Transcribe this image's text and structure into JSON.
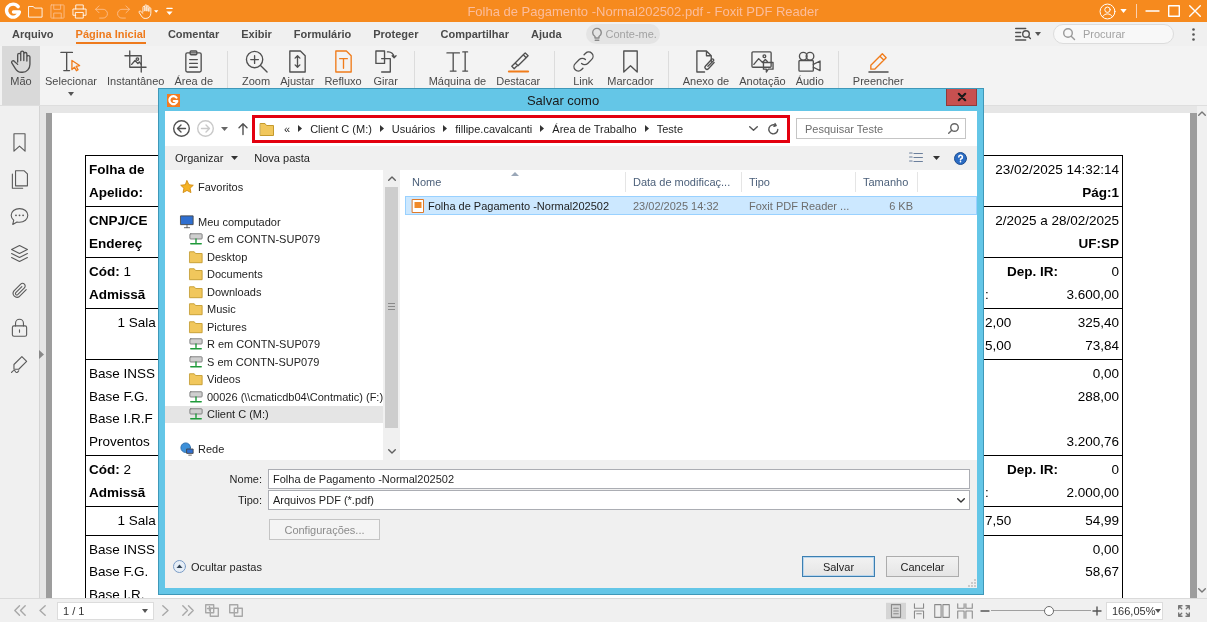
{
  "window": {
    "title": "Folha de Pagamento -Normal202502.pdf - Foxit PDF Reader",
    "quick_access": [
      {
        "disabled": false
      },
      {
        "disabled": true
      },
      {
        "disabled": false
      },
      {
        "disabled": true
      },
      {
        "disabled": true
      },
      {
        "disabled": false
      },
      {
        "disabled": false
      }
    ]
  },
  "menu_tabs": [
    {
      "label": "Arquivo",
      "selected": false
    },
    {
      "label": "Página Inicial",
      "selected": true
    },
    {
      "label": "Comentar",
      "selected": false
    },
    {
      "label": "Exibir",
      "selected": false
    },
    {
      "label": "Formulário",
      "selected": false
    },
    {
      "label": "Proteger",
      "selected": false
    },
    {
      "label": "Compartilhar",
      "selected": false
    },
    {
      "label": "Ajuda",
      "selected": false
    }
  ],
  "tell_me": {
    "placeholder": "Conte-me."
  },
  "search": {
    "placeholder": "Procurar"
  },
  "ribbon": {
    "groups": [
      {
        "items": [
          {
            "label": "Mão",
            "selected": true
          },
          {
            "label": "Selecionar",
            "selected": false
          },
          {
            "label": "Instantâneo",
            "selected": false
          },
          {
            "label": "Área de",
            "selected": false
          }
        ]
      },
      {
        "items": [
          {
            "label": "Zoom",
            "selected": false
          },
          {
            "label": "Ajustar",
            "selected": false
          },
          {
            "label": "Refluxo",
            "selected": false
          },
          {
            "label": "Girar",
            "selected": false
          }
        ]
      },
      {
        "items": [
          {
            "label": "Máquina de",
            "selected": false
          },
          {
            "label": "Destacar",
            "selected": false
          }
        ]
      },
      {
        "items": [
          {
            "label": "Link",
            "selected": false
          },
          {
            "label": "Marcador",
            "selected": false
          }
        ]
      },
      {
        "items": [
          {
            "label": "Anexo de",
            "selected": false
          },
          {
            "label": "Anotação",
            "selected": false
          },
          {
            "label": "Áudio",
            "selected": false
          }
        ]
      },
      {
        "items": [
          {
            "label": "Preencher",
            "selected": false
          }
        ]
      }
    ]
  },
  "document": {
    "blocks": [
      {
        "lines": [
          {
            "left": {
              "text": "Folha de",
              "kind": "label"
            },
            "right": {
              "text": "23/02/2025 14:32:14",
              "kind": "value"
            }
          },
          {
            "left": {
              "text": "Apelido:",
              "kind": "label"
            },
            "right": {
              "text": "Pág:1",
              "kind": "label"
            }
          }
        ]
      },
      {
        "lines": [
          {
            "left": {
              "text": "CNPJ/CE",
              "kind": "label"
            },
            "right": {
              "text": "2/2025 a 28/02/2025",
              "kind": "value"
            }
          },
          {
            "left": {
              "text": "Endereç",
              "kind": "label"
            },
            "right": {
              "text": "UF:SP",
              "kind": "label"
            }
          }
        ]
      },
      {
        "lines": [
          {
            "left": {
              "text": "**Cód:** 1",
              "kind": "value"
            },
            "mid": {
              "text": "Dep. IR:",
              "kind": "label"
            },
            "right": {
              "text": "0",
              "kind": "value"
            }
          },
          {
            "left": {
              "text": "Admissã",
              "kind": "label"
            },
            "mid": {
              "text": ":",
              "kind": "value"
            },
            "right": {
              "text": "3.600,00",
              "kind": "value"
            }
          }
        ]
      },
      {
        "lines": [
          {
            "left": {
              "text": "1 Sala",
              "kind": "item"
            },
            "mid": {
              "text": "2,00",
              "kind": "value"
            },
            "right": {
              "text": "325,40",
              "kind": "value"
            }
          },
          {
            "mid": {
              "text": "5,00",
              "kind": "value"
            },
            "right": {
              "text": "73,84",
              "kind": "value"
            }
          }
        ]
      },
      {
        "lines": [
          {
            "left": {
              "text": "Base INSS",
              "kind": "value"
            },
            "right": {
              "text": "0,00",
              "kind": "value"
            }
          },
          {
            "left": {
              "text": "Base F.G.",
              "kind": "value"
            },
            "right": {
              "text": "288,00",
              "kind": "value"
            }
          },
          {
            "left": {
              "text": "Base I.R.F",
              "kind": "value"
            }
          },
          {
            "left": {
              "text": "Proventos",
              "kind": "value"
            },
            "right": {
              "text": "3.200,76",
              "kind": "value"
            }
          }
        ]
      },
      {
        "lines": [
          {
            "left": {
              "text": "**Cód:** 2",
              "kind": "value"
            },
            "mid": {
              "text": "Dep. IR:",
              "kind": "label"
            },
            "right": {
              "text": "0",
              "kind": "value"
            }
          },
          {
            "left": {
              "text": "Admissã",
              "kind": "label"
            },
            "mid": {
              "text": ":",
              "kind": "value"
            },
            "right": {
              "text": "2.000,00",
              "kind": "value"
            }
          }
        ]
      },
      {
        "lines": [
          {
            "left": {
              "text": "1 Sala",
              "kind": "item"
            },
            "mid": {
              "text": "7,50",
              "kind": "value"
            },
            "right": {
              "text": "54,99",
              "kind": "value"
            }
          }
        ]
      },
      {
        "lines": [
          {
            "left": {
              "text": "Base INSS",
              "kind": "value"
            },
            "right": {
              "text": "0,00",
              "kind": "value"
            }
          },
          {
            "left": {
              "text": "Base F.G.",
              "kind": "value"
            },
            "right": {
              "text": "58,67",
              "kind": "value"
            }
          },
          {
            "left": {
              "text": "Base I.R.",
              "kind": "value"
            }
          }
        ]
      }
    ]
  },
  "status_bar": {
    "page": "1 / 1",
    "views": [
      {
        "selected": true
      },
      {
        "selected": false
      },
      {
        "selected": false
      },
      {
        "selected": false
      }
    ],
    "zoom_slider": {
      "level": 0.58
    },
    "zoom": "166,05%"
  },
  "dialog": {
    "title": "Salvar como",
    "history": [
      {
        "disabled": false
      },
      {
        "disabled": true
      }
    ],
    "address": {
      "highlighted": true,
      "overflow": "«",
      "crumbs": [
        "Client C (M:)",
        "Usuários",
        "fillipe.cavalcanti",
        "Área de Trabalho",
        "Teste"
      ]
    },
    "search": {
      "placeholder": "Pesquisar Teste"
    },
    "commands": [
      {
        "label": "Organizar",
        "kind": "menu"
      },
      {
        "label": "Nova pasta",
        "kind": "command"
      }
    ],
    "nav_tree": [
      {
        "label": "Favoritos",
        "kind": "favorites",
        "selected": false
      },
      {
        "label": "Meu computador",
        "kind": "computer",
        "selected": false,
        "children": [
          {
            "label": "C em CONTN-SUP079",
            "kind": "drive",
            "selected": false
          },
          {
            "label": "Desktop",
            "kind": "folder",
            "selected": false
          },
          {
            "label": "Documents",
            "kind": "folder",
            "selected": false
          },
          {
            "label": "Downloads",
            "kind": "folder",
            "selected": false
          },
          {
            "label": "Music",
            "kind": "folder",
            "selected": false
          },
          {
            "label": "Pictures",
            "kind": "folder",
            "selected": false
          },
          {
            "label": "R em CONTN-SUP079",
            "kind": "drive",
            "selected": false
          },
          {
            "label": "S em CONTN-SUP079",
            "kind": "drive",
            "selected": false
          },
          {
            "label": "Videos",
            "kind": "folder",
            "selected": false
          },
          {
            "label": "00026 (\\\\cmaticdb04\\Contmatic) (F:)",
            "kind": "drive",
            "selected": false
          },
          {
            "label": "Client C (M:)",
            "kind": "drive",
            "selected": true
          }
        ]
      },
      {
        "label": "Rede",
        "kind": "network",
        "selected": false
      }
    ],
    "columns": [
      {
        "label": "Nome",
        "sorted": true
      },
      {
        "label": "Data de modificaç...",
        "sorted": false
      },
      {
        "label": "Tipo",
        "sorted": false
      },
      {
        "label": "Tamanho",
        "sorted": false
      }
    ],
    "files": [
      {
        "name": "Folha de Pagamento -Normal202502",
        "modified": "23/02/2025 14:32",
        "type": "Foxit PDF Reader ...",
        "size": "6 KB",
        "selected": true
      }
    ],
    "filename": {
      "label": "Nome:",
      "value": "Folha de Pagamento -Normal202502"
    },
    "filetype": {
      "label": "Tipo:",
      "value": "Arquivos PDF (*.pdf)"
    },
    "options_button": {
      "label": "Configurações...",
      "disabled": true
    },
    "hide_folders": {
      "label": "Ocultar pastas"
    },
    "buttons": [
      {
        "label": "Salvar",
        "kind": "default"
      },
      {
        "label": "Cancelar",
        "kind": "normal"
      }
    ]
  }
}
